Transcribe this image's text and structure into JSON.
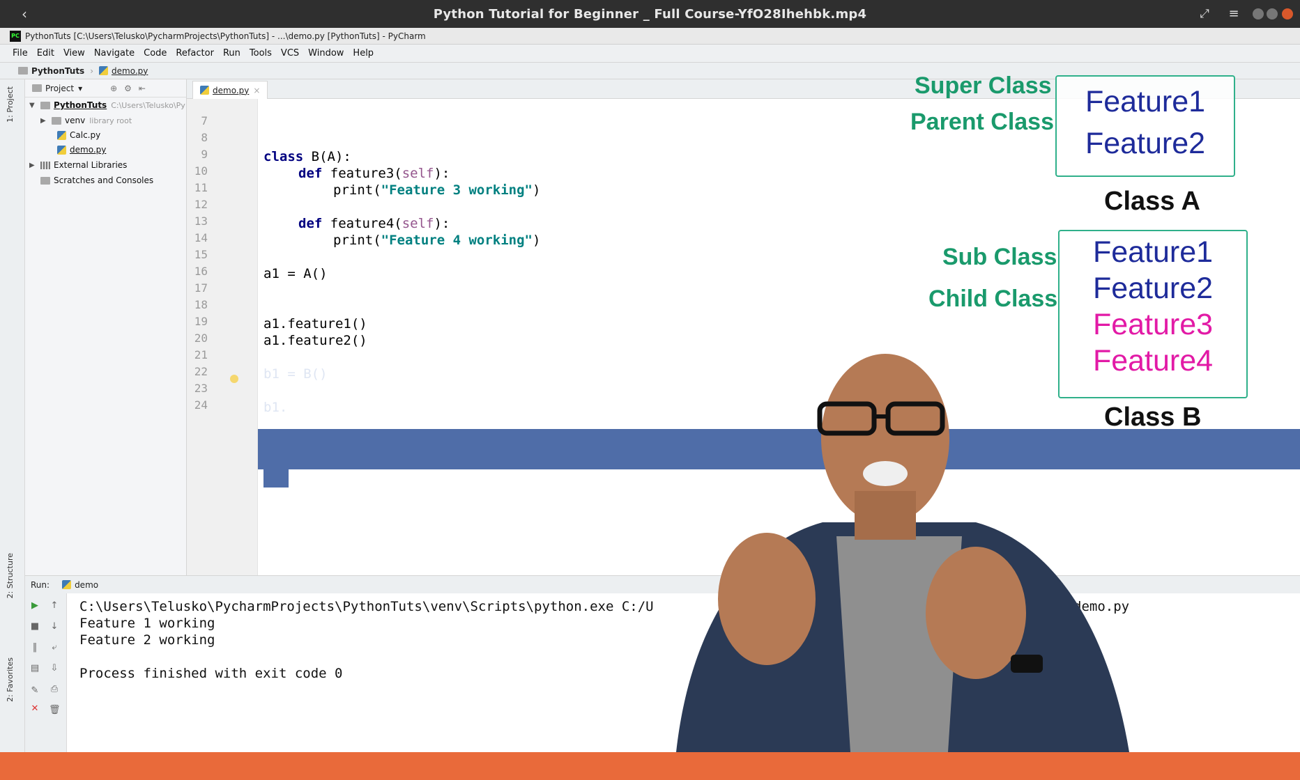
{
  "player": {
    "title": "Python Tutorial for Beginner _ Full Course-YfO28Ihehbk.mp4",
    "back_icon": "‹",
    "expand_icon": "⤢",
    "menu_icon": "≡"
  },
  "pycharm": {
    "window_title": "PythonTuts [C:\\Users\\Telusko\\PycharmProjects\\PythonTuts] - ...\\demo.py [PythonTuts] - PyCharm",
    "menu": [
      "File",
      "Edit",
      "View",
      "Navigate",
      "Code",
      "Refactor",
      "Run",
      "Tools",
      "VCS",
      "Window",
      "Help"
    ],
    "breadcrumb": [
      "PythonTuts",
      "demo.py"
    ],
    "project_label": "Project",
    "tree": {
      "root": "PythonTuts",
      "root_path": "C:\\Users\\Telusko\\Py",
      "venv": "venv",
      "venv_note": "library root",
      "files": [
        "Calc.py",
        "demo.py"
      ],
      "external": "External Libraries",
      "scratches": "Scratches and Consoles"
    },
    "tab": "demo.py",
    "line_numbers": [
      "7",
      "8",
      "9",
      "10",
      "11",
      "12",
      "13",
      "14",
      "15",
      "16",
      "17",
      "18",
      "19",
      "20",
      "21",
      "22",
      "23",
      "24"
    ],
    "run_label": "Run:",
    "run_config": "demo",
    "side_tabs": [
      "1: Project",
      "2: Structure",
      "2: Favorites"
    ]
  },
  "code": {
    "l9_kw": "class",
    "l9_rest": " B(A):",
    "l10_kw": "def",
    "l10_name": " feature3(",
    "l10_self": "self",
    "l10_end": "):",
    "l11_fn": "print(",
    "l11_str": "\"Feature 3 working\"",
    "l11_end": ")",
    "l13_kw": "def",
    "l13_name": " feature4(",
    "l13_self": "self",
    "l13_end": "):",
    "l14_fn": "print(",
    "l14_str": "\"Feature 4 working\"",
    "l14_end": ")",
    "l16": "a1 = A()",
    "l19": "a1.feature1()",
    "l20": "a1.feature2()",
    "l22": "b1 = B()",
    "l24": "b1."
  },
  "console": {
    "cmd_start": "C:\\Users\\Telusko\\PycharmProjects\\PythonTuts\\venv\\Scripts\\python.exe C:/U",
    "cmd_end": "demo.py",
    "out1": "Feature 1 working",
    "out2": "Feature 2 working",
    "exit": "Process finished with exit code 0"
  },
  "diagram": {
    "super_label": "Super Class",
    "parent_label": "Parent Class",
    "class_a": {
      "name": "Class A",
      "features": [
        "Feature1",
        "Feature2"
      ]
    },
    "sub_label": "Sub Class",
    "child_label": "Child Class",
    "class_b": {
      "name": "Class B",
      "features": [
        "Feature1",
        "Feature2",
        "Feature3",
        "Feature4"
      ]
    },
    "colors": {
      "inherited": "#1e2b9a",
      "new": "#e21aa6",
      "label": "#1a9a6c",
      "border": "#2fb08a"
    }
  },
  "progress": {
    "fraction": 0.0
  }
}
